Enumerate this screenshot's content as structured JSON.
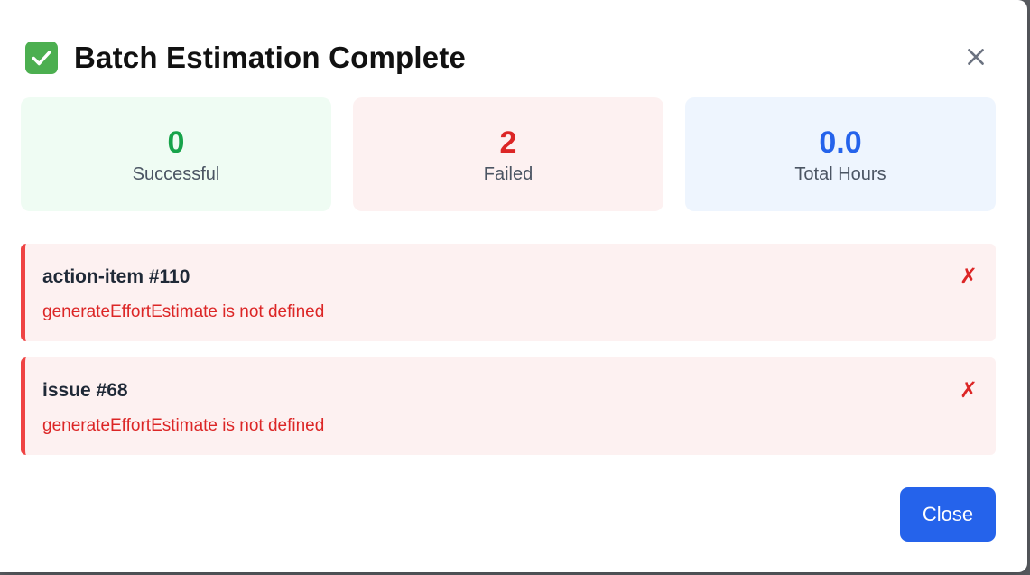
{
  "dialog": {
    "title": "Batch Estimation Complete",
    "title_icon": "check-mark-icon",
    "close_icon": "close-icon"
  },
  "stats": [
    {
      "value": "0",
      "label": "Successful",
      "color": "#17a34a"
    },
    {
      "value": "2",
      "label": "Failed",
      "color": "#dc2626"
    },
    {
      "value": "0.0",
      "label": "Total Hours",
      "color": "#2563eb"
    }
  ],
  "results": [
    {
      "title": "action-item #110",
      "error": "generateEffortEstimate is not defined",
      "status": "✗"
    },
    {
      "title": "issue #68",
      "error": "generateEffortEstimate is not defined",
      "status": "✗"
    }
  ],
  "footer": {
    "close_label": "Close"
  },
  "colors": {
    "accent": "#2563eb",
    "error": "#dc2626",
    "success": "#17a34a"
  }
}
